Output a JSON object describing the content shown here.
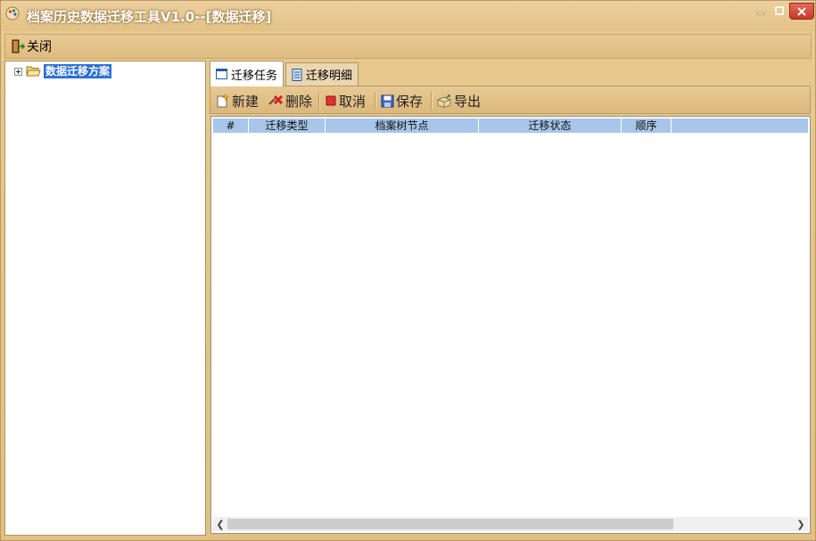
{
  "window": {
    "title": "档案历史数据迁移工具V1.0--[数据迁移]"
  },
  "menubar": {
    "close_label": "关闭"
  },
  "tree": {
    "root_label": "数据迁移方案"
  },
  "tabs": [
    {
      "label": "迁移任务"
    },
    {
      "label": "迁移明细"
    }
  ],
  "toolbar": {
    "new_label": "新建",
    "delete_label": "删除",
    "cancel_label": "取消",
    "save_label": "保存",
    "export_label": "导出"
  },
  "grid": {
    "columns": [
      "#",
      "迁移类型",
      "档案树节点",
      "迁移状态",
      "顺序"
    ],
    "rows": []
  },
  "colors": {
    "chrome": "#e3c187",
    "selection": "#2a6fd6",
    "grid_header": "#a7c6ea",
    "close_button": "#c73a2a"
  },
  "icons": {
    "app": "app-icon",
    "close_menu": "exit-door-icon",
    "tree_folder": "folder-open-icon",
    "tab_task": "window-icon",
    "tab_detail": "document-icon",
    "new": "new-document-icon",
    "delete": "delete-x-icon",
    "cancel": "stop-icon",
    "save": "floppy-disk-icon",
    "export": "export-box-icon"
  }
}
